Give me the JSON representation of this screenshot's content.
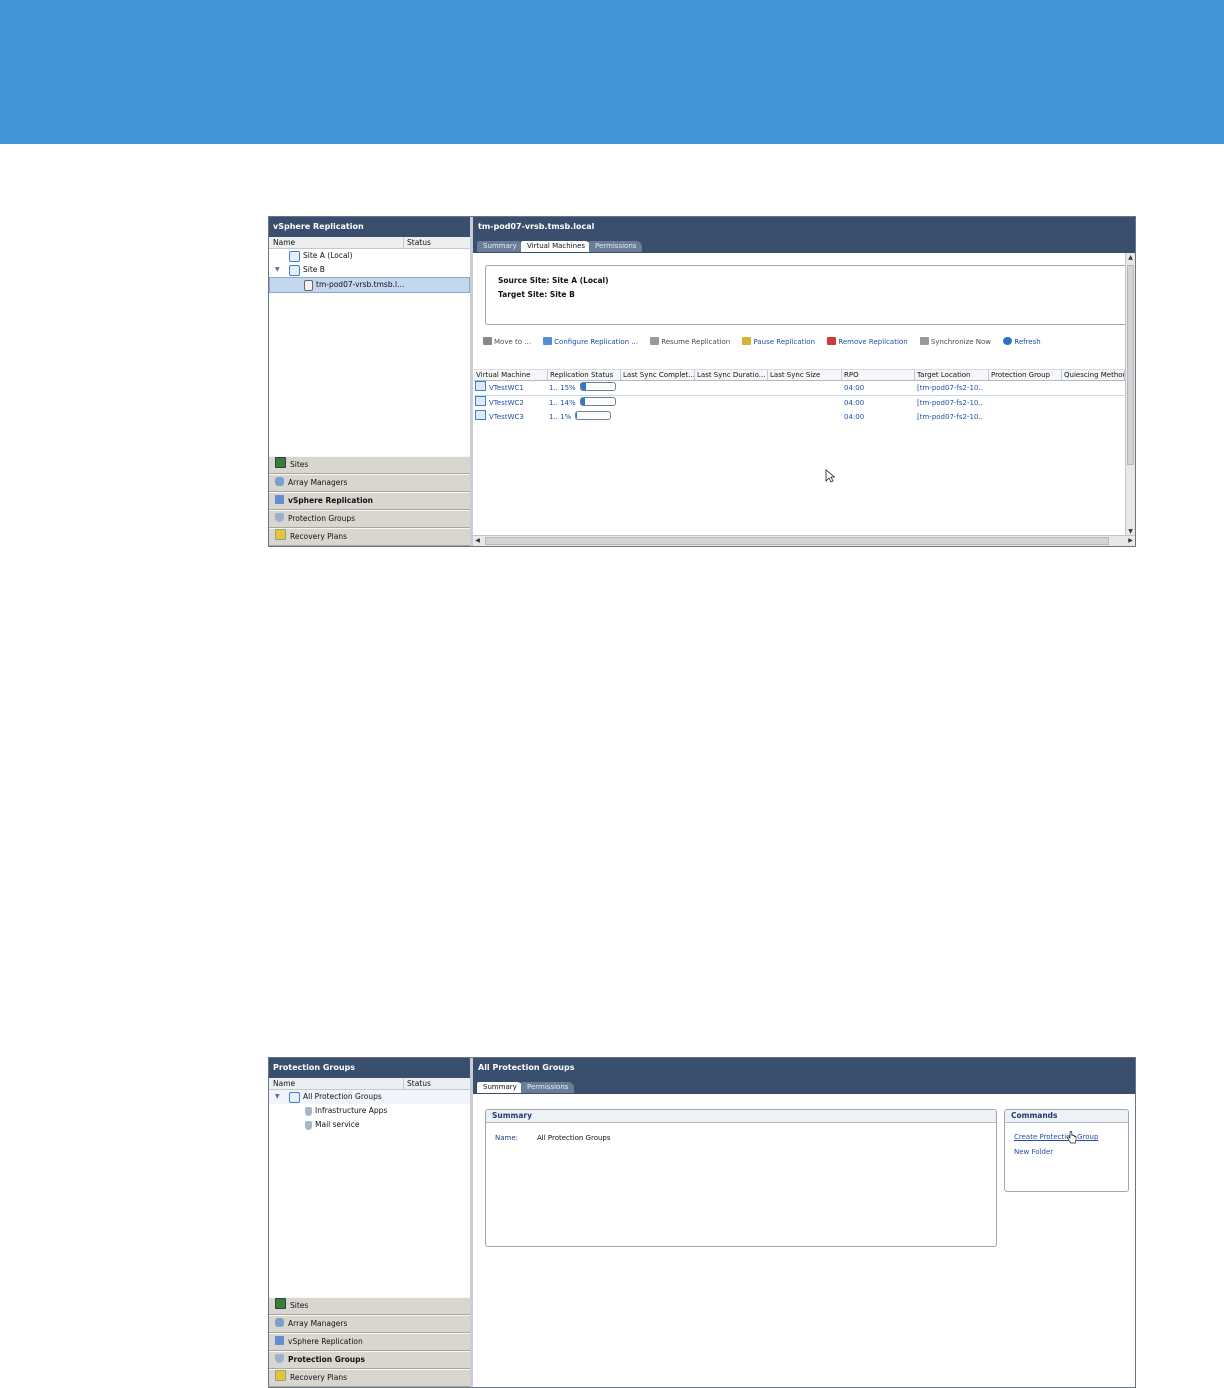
{
  "screen1": {
    "left_panel": {
      "title": "vSphere Replication",
      "col_name": "Name",
      "col_status": "Status",
      "tree": [
        {
          "label": "Site A (Local)"
        },
        {
          "label": "Site B"
        },
        {
          "label": "tm-pod07-vrsb.tmsb.l..."
        }
      ]
    },
    "nav": [
      "Sites",
      "Array Managers",
      "vSphere Replication",
      "Protection Groups",
      "Recovery Plans"
    ],
    "right_panel": {
      "title": "tm-pod07-vrsb.tmsb.local",
      "tabs": [
        "Summary",
        "Virtual Machines",
        "Permissions"
      ],
      "source_site": "Source Site: Site A (Local)",
      "target_site": "Target Site: Site B",
      "toolbar": [
        "Move to ...",
        "Configure Replication ...",
        "Resume Replication",
        "Pause Replication",
        "Remove Replication",
        "Synchronize Now",
        "Refresh"
      ],
      "columns": [
        "Virtual Machine",
        "Replication Status",
        "Last Sync Complet...",
        "Last Sync Duratio...",
        "Last Sync Size",
        "RPO",
        "Target Location",
        "Protection Group",
        "Quiescing Method"
      ],
      "rows": [
        {
          "vm": "VTestWC1",
          "status": "1..",
          "pct": "15%",
          "progress": 0.15,
          "rpo": "04:00",
          "target": "[tm-pod07-fs2-10.."
        },
        {
          "vm": "VTestWC2",
          "status": "1..",
          "pct": "14%",
          "progress": 0.14,
          "rpo": "04:00",
          "target": "[tm-pod07-fs2-10.."
        },
        {
          "vm": "VTestWC3",
          "status": "1..",
          "pct": "1%",
          "progress": 0.01,
          "rpo": "04:00",
          "target": "[tm-pod07-fs2-10.."
        }
      ]
    }
  },
  "screen2": {
    "left_panel": {
      "title": "Protection Groups",
      "col_name": "Name",
      "col_status": "Status",
      "tree": [
        {
          "label": "All Protection Groups"
        },
        {
          "label": "Infrastructure Apps"
        },
        {
          "label": "Mail service"
        }
      ]
    },
    "nav": [
      "Sites",
      "Array Managers",
      "vSphere Replication",
      "Protection Groups",
      "Recovery Plans"
    ],
    "right_panel": {
      "title": "All Protection Groups",
      "tabs": [
        "Summary",
        "Permissions"
      ],
      "summary_title": "Summary",
      "name_label": "Name:",
      "name_value": "All Protection Groups",
      "commands_title": "Commands",
      "commands": [
        "Create Protection Group",
        "New Folder"
      ]
    }
  }
}
